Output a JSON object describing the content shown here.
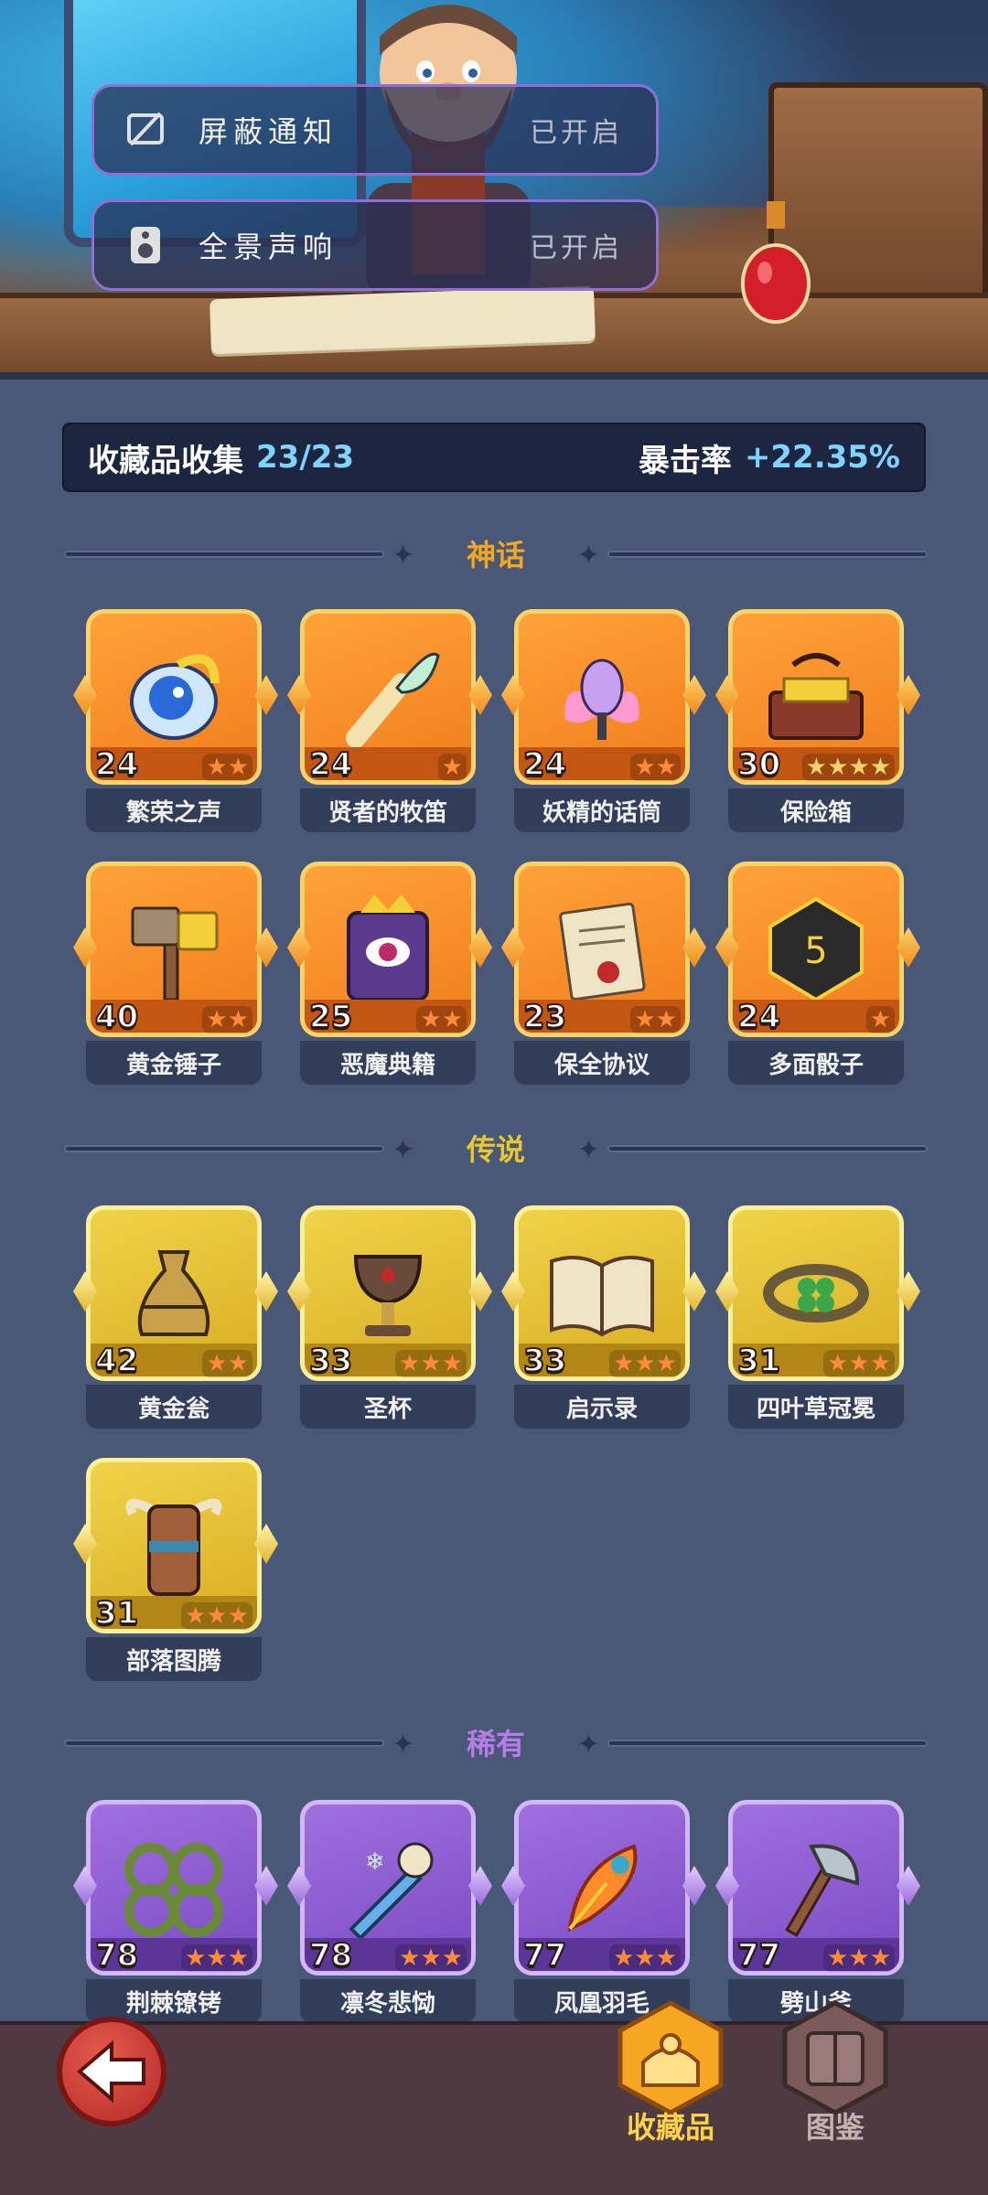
{
  "settings": [
    {
      "label": "屏蔽通知",
      "status": "已开启",
      "icon": "mute-notification-icon"
    },
    {
      "label": "全景声响",
      "status": "已开启",
      "icon": "speaker-icon"
    }
  ],
  "summary": {
    "collection_label": "收藏品收集",
    "collection_value": "23/23",
    "crit_label": "暴击率",
    "crit_value": "+22.35%"
  },
  "colors": {
    "mythic": "#f5a623",
    "legend": "#e8c832",
    "rare": "#b47ee6",
    "accent_blue": "#7fd4ff"
  },
  "sections": [
    {
      "title": "神话",
      "tier": "mythic",
      "items": [
        {
          "name": "繁荣之声",
          "level": "24",
          "stars": 2,
          "icon": "blue-spirit-shell-icon"
        },
        {
          "name": "贤者的牧笛",
          "level": "24",
          "stars": 1,
          "icon": "feather-flute-icon"
        },
        {
          "name": "妖精的话筒",
          "level": "24",
          "stars": 2,
          "icon": "fairy-microphone-icon"
        },
        {
          "name": "保险箱",
          "level": "30",
          "stars": 4,
          "icon": "gold-chest-icon"
        },
        {
          "name": "黄金锤子",
          "level": "40",
          "stars": 2,
          "icon": "golden-hammer-icon"
        },
        {
          "name": "恶魔典籍",
          "level": "25",
          "stars": 2,
          "icon": "demon-tome-icon"
        },
        {
          "name": "保全协议",
          "level": "23",
          "stars": 2,
          "icon": "sealed-contract-icon"
        },
        {
          "name": "多面骰子",
          "level": "24",
          "stars": 1,
          "icon": "dice-icon"
        }
      ]
    },
    {
      "title": "传说",
      "tier": "legend",
      "items": [
        {
          "name": "黄金瓮",
          "level": "42",
          "stars": 2,
          "icon": "golden-urn-icon"
        },
        {
          "name": "圣杯",
          "level": "33",
          "stars": 3,
          "icon": "grail-icon"
        },
        {
          "name": "启示录",
          "level": "33",
          "stars": 3,
          "icon": "open-book-icon"
        },
        {
          "name": "四叶草冠冕",
          "level": "31",
          "stars": 3,
          "icon": "clover-crown-icon"
        },
        {
          "name": "部落图腾",
          "level": "31",
          "stars": 3,
          "icon": "tribal-totem-icon"
        }
      ]
    },
    {
      "title": "稀有",
      "tier": "rare",
      "items": [
        {
          "name": "荆棘镣铐",
          "level": "78",
          "stars": 3,
          "icon": "thorn-shackles-icon"
        },
        {
          "name": "凛冬悲恸",
          "level": "78",
          "stars": 3,
          "icon": "frost-sword-icon"
        },
        {
          "name": "凤凰羽毛",
          "level": "77",
          "stars": 3,
          "icon": "phoenix-feather-icon"
        },
        {
          "name": "劈山斧",
          "level": "77",
          "stars": 3,
          "icon": "battle-axe-icon"
        }
      ]
    }
  ],
  "nav": {
    "back_icon": "back-arrow-icon",
    "tabs": [
      {
        "label": "收藏品",
        "active": true,
        "icon": "collection-icon"
      },
      {
        "label": "图鉴",
        "active": false,
        "icon": "codex-book-icon"
      }
    ]
  }
}
